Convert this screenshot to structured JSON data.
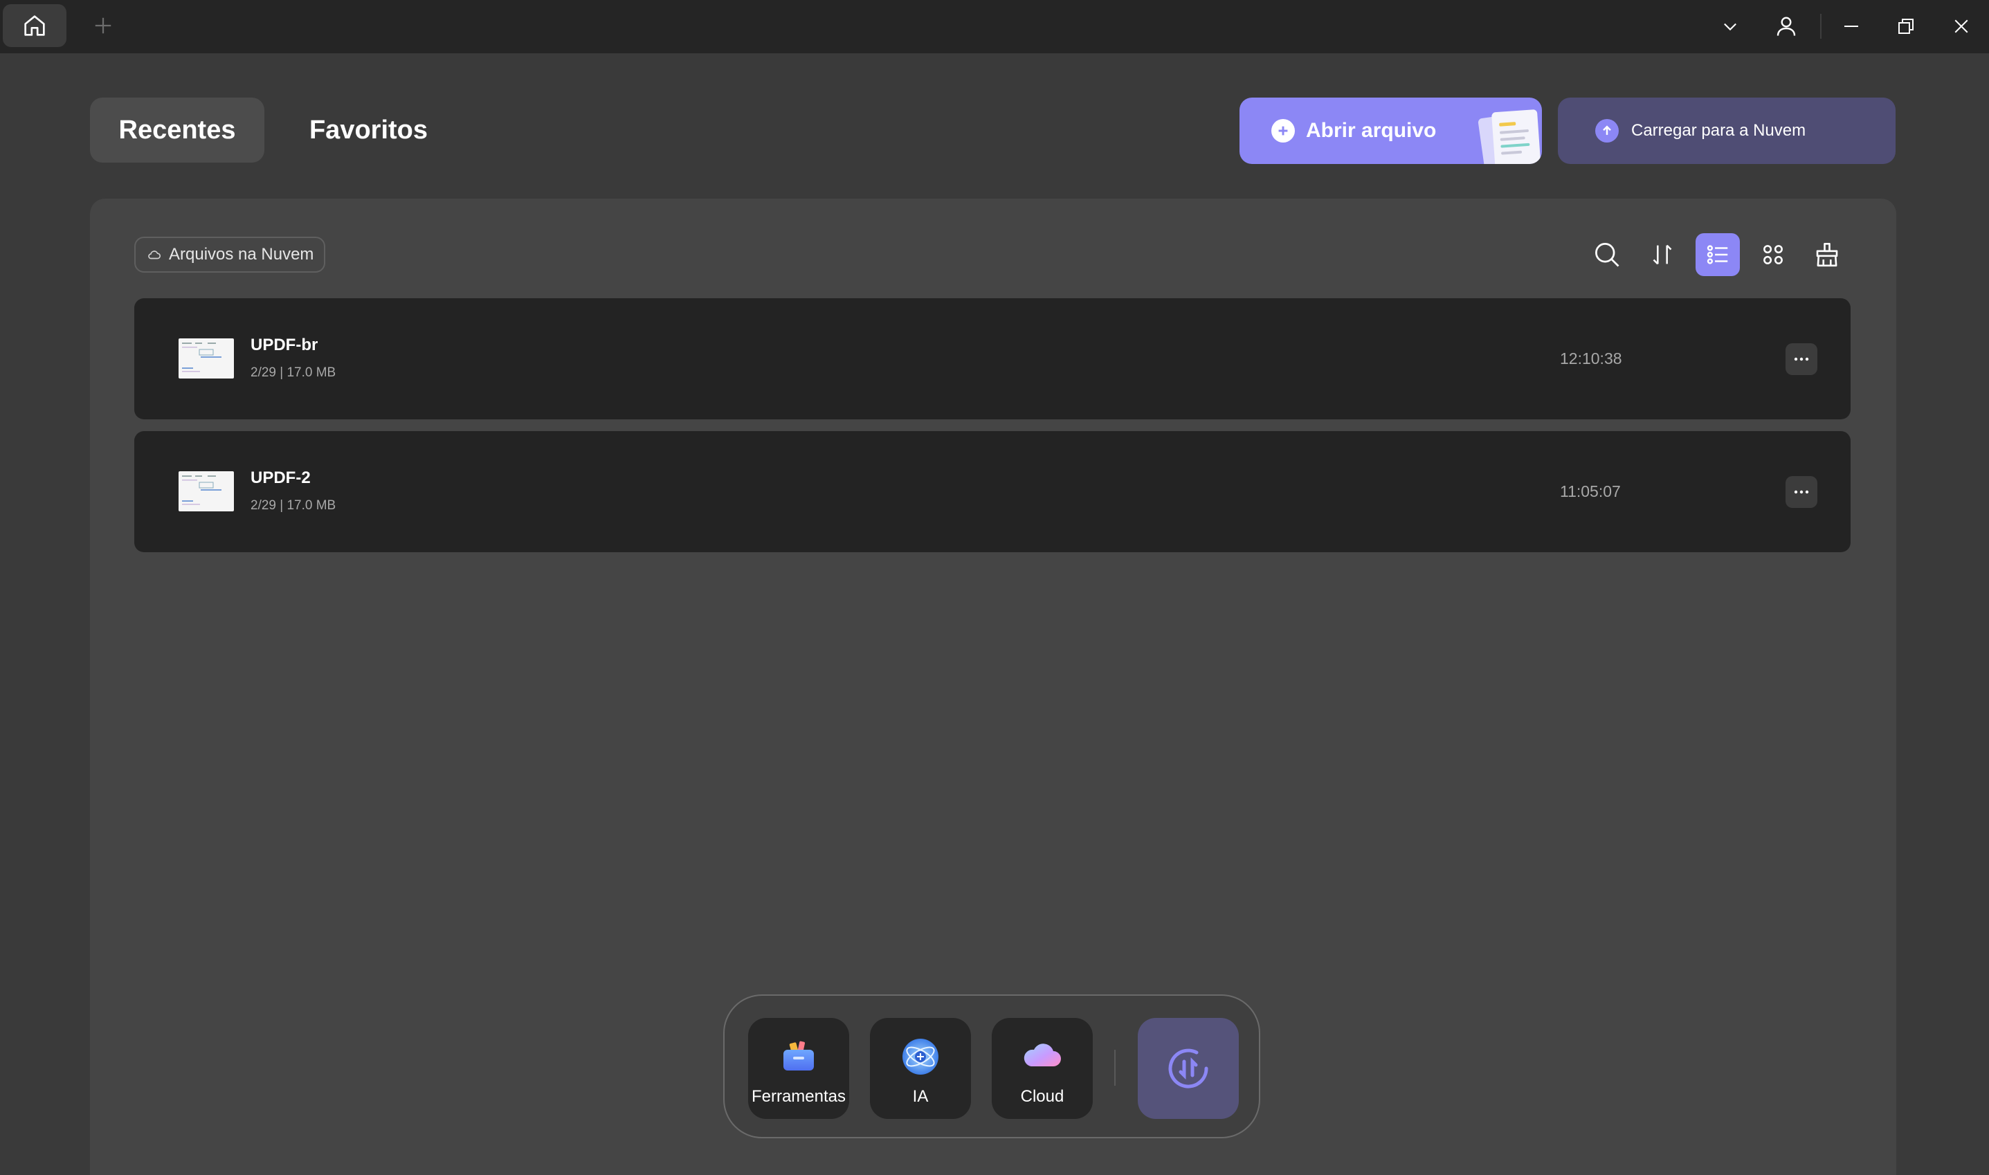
{
  "tabs": [
    {
      "label": "Recentes",
      "active": true
    },
    {
      "label": "Favoritos",
      "active": false
    }
  ],
  "actions": {
    "open_label": "Abrir arquivo",
    "upload_label": "Carregar para a Nuvem"
  },
  "panel": {
    "cloud_filter_label": "Arquivos na Nuvem",
    "view_mode": "list"
  },
  "files": [
    {
      "name": "UPDF-br",
      "meta": "2/29 | 17.0 MB",
      "time": "12:10:38"
    },
    {
      "name": "UPDF-2",
      "meta": "2/29 | 17.0 MB",
      "time": "11:05:07"
    }
  ],
  "dock": {
    "items": [
      {
        "label": "Ferramentas",
        "icon": "toolbox-icon"
      },
      {
        "label": "IA",
        "icon": "ai-icon"
      },
      {
        "label": "Cloud",
        "icon": "cloud-icon"
      }
    ]
  },
  "colors": {
    "accent": "#8c87f5",
    "accent_muted": "#4f4d74",
    "background": "#3a3a3a",
    "panel": "#454545",
    "row": "#232323"
  }
}
